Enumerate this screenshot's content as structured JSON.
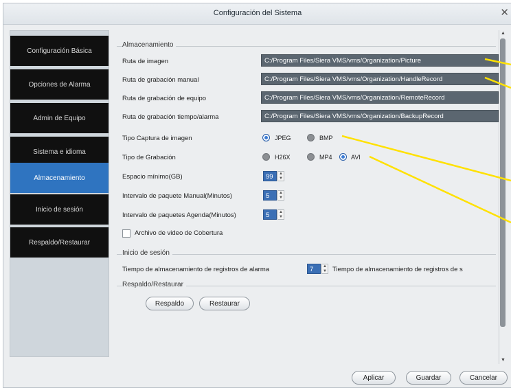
{
  "window": {
    "title": "Configuración del Sistema",
    "close": "✕"
  },
  "sidebar": {
    "items": [
      {
        "label": "Configuración Básica"
      },
      {
        "label": "Opciones de Alarma"
      },
      {
        "label": "Admin de Equipo"
      },
      {
        "label": "Sistema e idioma"
      },
      {
        "label": "Almacenamiento"
      },
      {
        "label": "Inicio de sesión"
      },
      {
        "label": "Respaldo/Restaurar"
      }
    ],
    "active_index": 4
  },
  "storage": {
    "group_title": "Almacenamiento",
    "image_path": {
      "label": "Ruta de imagen",
      "value": "C:/Program Files/Siera VMS/vms/Organization/Picture"
    },
    "manual_path": {
      "label": "Ruta de grabación manual",
      "value": "C:/Program Files/Siera VMS/vms/Organization/HandleRecord"
    },
    "device_path": {
      "label": "Ruta de grabación de equipo",
      "value": "C:/Program Files/Siera VMS/vms/Organization/RemoteRecord"
    },
    "backup_path": {
      "label": "Ruta de grabación tiempo/alarma",
      "value": "C:/Program Files/Siera VMS/vms/Organization/BackupRecord"
    },
    "capture_type": {
      "label": "Tipo Captura de imagen",
      "options": [
        "JPEG",
        "BMP"
      ],
      "selected": "JPEG"
    },
    "record_type": {
      "label": "Tipo de Grabación",
      "options": [
        "H26X",
        "MP4",
        "AVI"
      ],
      "selected": "AVI"
    },
    "min_space": {
      "label": "Espacio mínimo(GB)",
      "value": "99"
    },
    "manual_interval": {
      "label": "Intervalo de paquete Manual(Minutos)",
      "value": "5"
    },
    "schedule_interval": {
      "label": "Intervalo de paquetes Agenda(Minutos)",
      "value": "5"
    },
    "cover_video": {
      "label": "Archivo de video de Cobertura",
      "checked": false
    }
  },
  "login": {
    "group_title": "Inicio de sesión",
    "alarm_storage_label": "Tiempo de almacenamiento de registros de alarma",
    "alarm_storage_value": "7",
    "alarm_storage_label2": "Tiempo de almacenamiento de registros de s"
  },
  "backup": {
    "group_title": "Respaldo/Restaurar",
    "backup_button": "Respaldo",
    "restore_button": "Restaurar"
  },
  "footer": {
    "apply": "Aplicar",
    "save": "Guardar",
    "cancel": "Cancelar"
  },
  "colors": {
    "active_nav": "#2f74c0",
    "annotation": "#ffe100",
    "path_field": "#5b6670",
    "spin_field": "#3b6fb5"
  }
}
